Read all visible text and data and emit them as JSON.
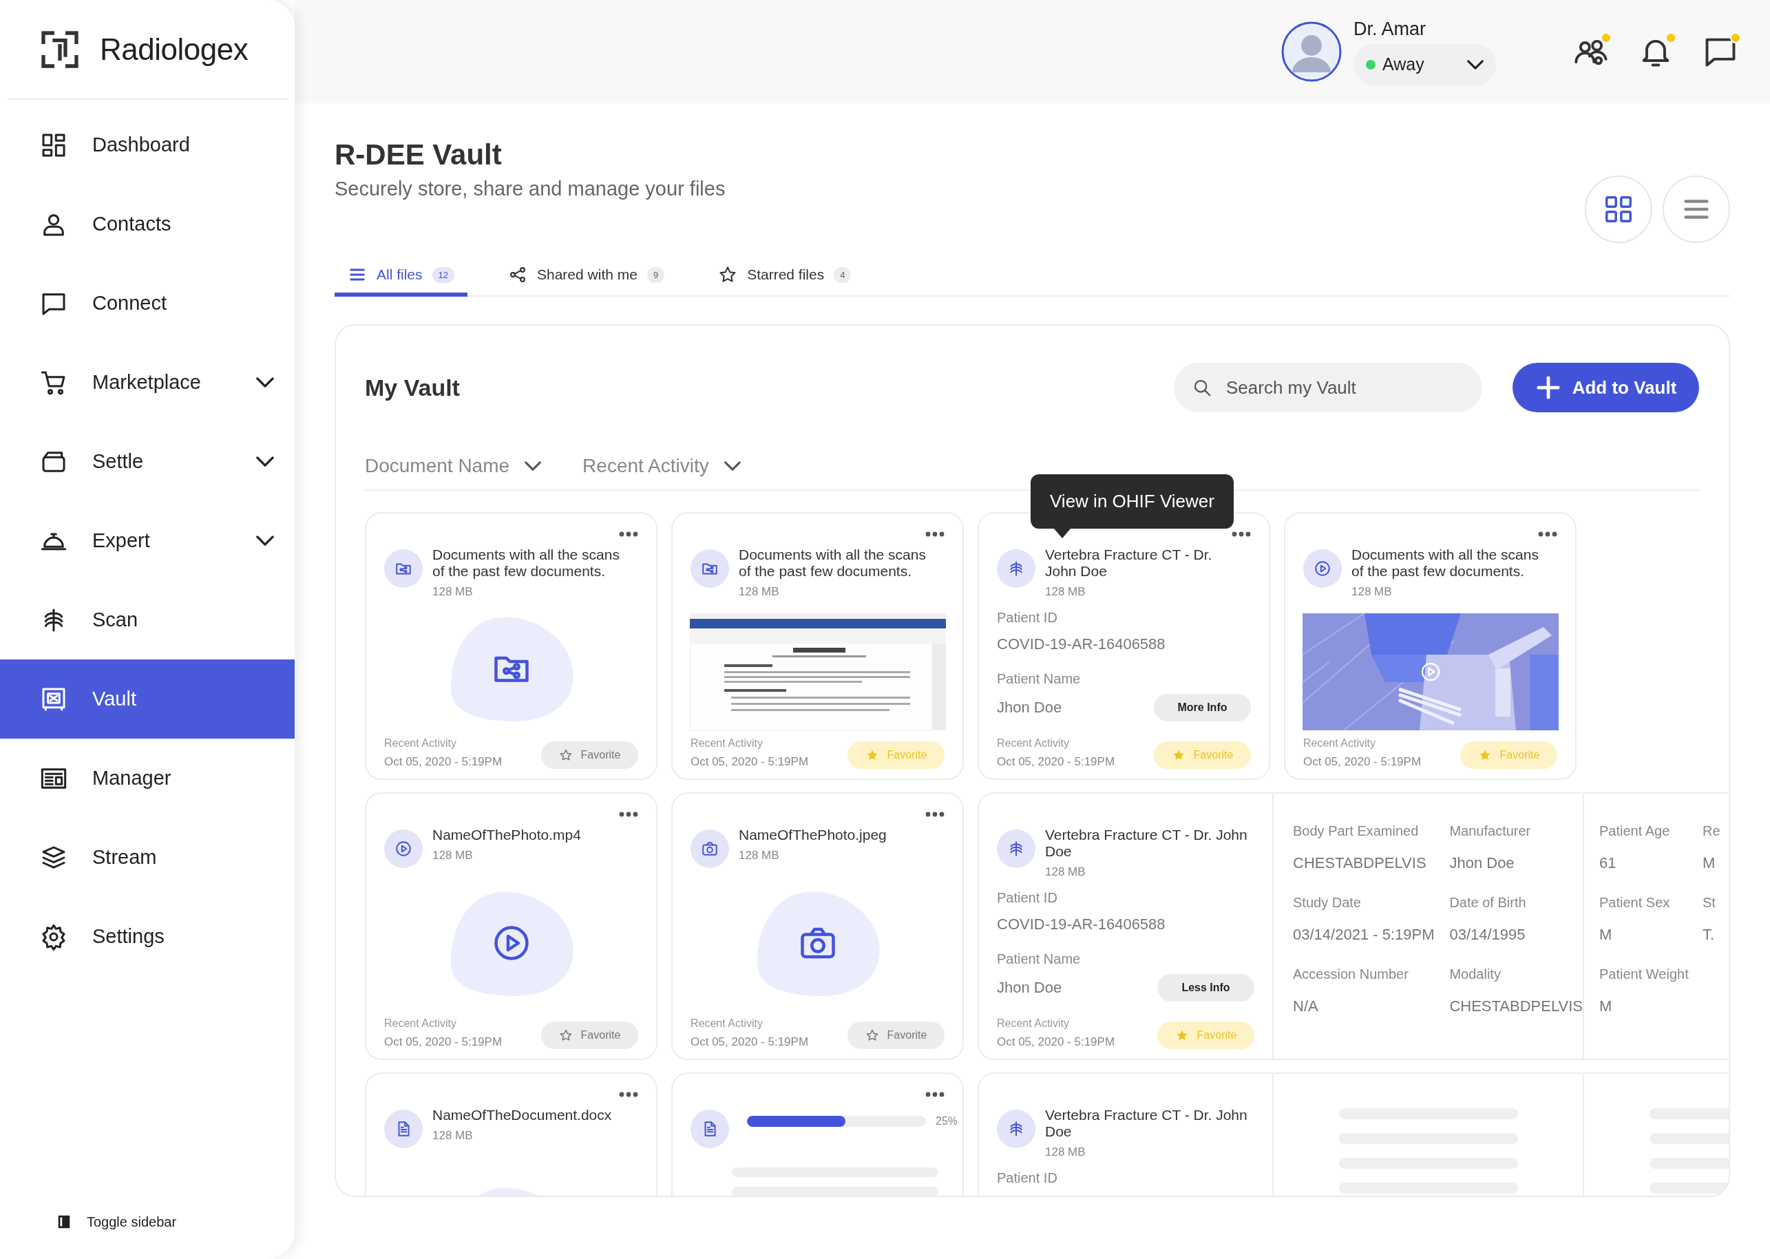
{
  "sidebar": {
    "logo": "Radiologex",
    "items": [
      {
        "label": "Dashboard",
        "expandable": false,
        "selected": false
      },
      {
        "label": "Contacts",
        "expandable": false,
        "selected": false
      },
      {
        "label": "Connect",
        "expandable": false,
        "selected": false
      },
      {
        "label": "Marketplace",
        "expandable": true,
        "selected": false
      },
      {
        "label": "Settle",
        "expandable": true,
        "selected": false
      },
      {
        "label": "Expert",
        "expandable": true,
        "selected": false
      },
      {
        "label": "Scan",
        "expandable": false,
        "selected": false
      },
      {
        "label": "Vault",
        "expandable": false,
        "selected": true
      },
      {
        "label": "Manager",
        "expandable": false,
        "selected": false
      },
      {
        "label": "Stream",
        "expandable": false,
        "selected": false
      },
      {
        "label": "Settings",
        "expandable": false,
        "selected": false
      }
    ],
    "toggle": "Toggle sidebar"
  },
  "header": {
    "user": {
      "name": "Dr. Amar",
      "status": "Away",
      "online": true
    },
    "actions": [
      {
        "badge": true
      },
      {
        "badge": true
      },
      {
        "badge": true
      }
    ]
  },
  "page": {
    "title": "R-DEE Vault",
    "subtitle": "Securely store, share and manage your files",
    "views": [
      {
        "selected": true
      },
      {
        "selected": false
      }
    ]
  },
  "tabs": [
    {
      "label": "All files",
      "count": "12",
      "selected": true
    },
    {
      "label": "Shared with me",
      "count": "9",
      "selected": false
    },
    {
      "label": "Starred files",
      "count": "4",
      "selected": false
    }
  ],
  "vault": {
    "title": "My Vault",
    "search": {
      "placeholder": "Search my Vault"
    },
    "add_button": "Add to Vault",
    "filters": [
      "Document Name",
      "Recent Activity"
    ],
    "tooltip": "View in OHIF Viewer",
    "rows": [
      [
        {
          "kind": "folder",
          "title": "Documents with all the scans of the past few documents.",
          "size": "128 MB",
          "activity_label": "Recent Activity",
          "activity_date": "Oct 05, 2020 - 5:19PM",
          "favorite": {
            "label": "Favorite",
            "selected": false
          }
        },
        {
          "kind": "folder",
          "title": "Documents with all the scans of the past few documents.",
          "size": "128 MB",
          "activity_label": "Recent Activity",
          "activity_date": "Oct 05, 2020 - 5:19PM",
          "favorite": {
            "label": "Favorite",
            "selected": true
          }
        },
        {
          "kind": "scan",
          "title": "Vertebra Fracture CT - Dr. John Doe",
          "size": "128 MB",
          "fields": [
            {
              "label": "Patient ID",
              "value": "COVID-19-AR-16406588"
            },
            {
              "label": "Patient Name",
              "value": "Jhon Doe"
            }
          ],
          "info_button": "More Info",
          "expanded": false,
          "activity_label": "Recent Activity",
          "activity_date": "Oct 05, 2020 - 5:19PM",
          "favorite": {
            "label": "Favorite",
            "selected": true
          }
        },
        {
          "kind": "video",
          "title": "Documents with all the scans of the past few documents.",
          "size": "128 MB",
          "activity_label": "Recent Activity",
          "activity_date": "Oct 05, 2020 - 5:19PM",
          "favorite": {
            "label": "Favorite",
            "selected": true
          }
        }
      ],
      [
        {
          "kind": "video",
          "title": "NameOfThePhoto.mp4",
          "size": "128 MB",
          "activity_label": "Recent Activity",
          "activity_date": "Oct 05, 2020 - 5:19PM",
          "favorite": {
            "label": "Favorite",
            "selected": false
          }
        },
        {
          "title": "NameOfThePhoto.jpeg",
          "size": "128 MB",
          "activity_label": "Recent Activity",
          "activity_date": "Oct 05, 2020 - 5:19PM",
          "favorite": {
            "label": "Favorite",
            "selected": false
          }
        },
        {
          "kind": "scan",
          "title": "Vertebra Fracture CT - Dr. John Doe",
          "size": "128 MB",
          "fields": [
            {
              "label": "Patient ID",
              "value": "COVID-19-AR-16406588"
            },
            {
              "label": "Patient Name",
              "value": "Jhon Doe"
            }
          ],
          "info_button": "Less Info",
          "expanded": true,
          "loading": false,
          "activity_label": "Recent Activity",
          "activity_date": "Oct 05, 2020 - 5:19PM",
          "favorite": {
            "label": "Favorite",
            "selected": true
          },
          "details": [
            {
              "columns": [
                [
                  {
                    "label": "Body Part Examined",
                    "value": "CHESTABDPELVIS"
                  },
                  {
                    "label": "Study Date",
                    "value": "03/14/2021 - 5:19PM"
                  },
                  {
                    "label": "Accession Number",
                    "value": "N/A"
                  }
                ],
                [
                  {
                    "label": "Manufacturer",
                    "value": "Jhon Doe"
                  },
                  {
                    "label": "Date of Birth",
                    "value": "03/14/1995"
                  },
                  {
                    "label": "Modality",
                    "value": "CHESTABDPELVIS"
                  }
                ]
              ]
            },
            {
              "columns": [
                [
                  {
                    "label": "Patient Age",
                    "value": "61"
                  },
                  {
                    "label": "Patient Sex",
                    "value": "M"
                  },
                  {
                    "label": "Patient Weight",
                    "value": "M"
                  }
                ],
                [
                  {
                    "label": "Re",
                    "value": "M"
                  },
                  {
                    "label": "St",
                    "value": "T."
                  }
                ]
              ]
            }
          ]
        }
      ],
      [
        {
          "kind": "document",
          "title": "NameOfTheDocument.docx",
          "size": "128 MB"
        },
        {
          "kind": "upload",
          "progress": {
            "level": 0.55,
            "reading": "25%"
          }
        },
        {
          "kind": "scan",
          "title": "Vertebra Fracture CT - Dr. John Doe",
          "size": "128 MB",
          "fields": [
            {
              "label": "Patient ID"
            }
          ],
          "expanded": true,
          "loading": true
        }
      ]
    ]
  }
}
